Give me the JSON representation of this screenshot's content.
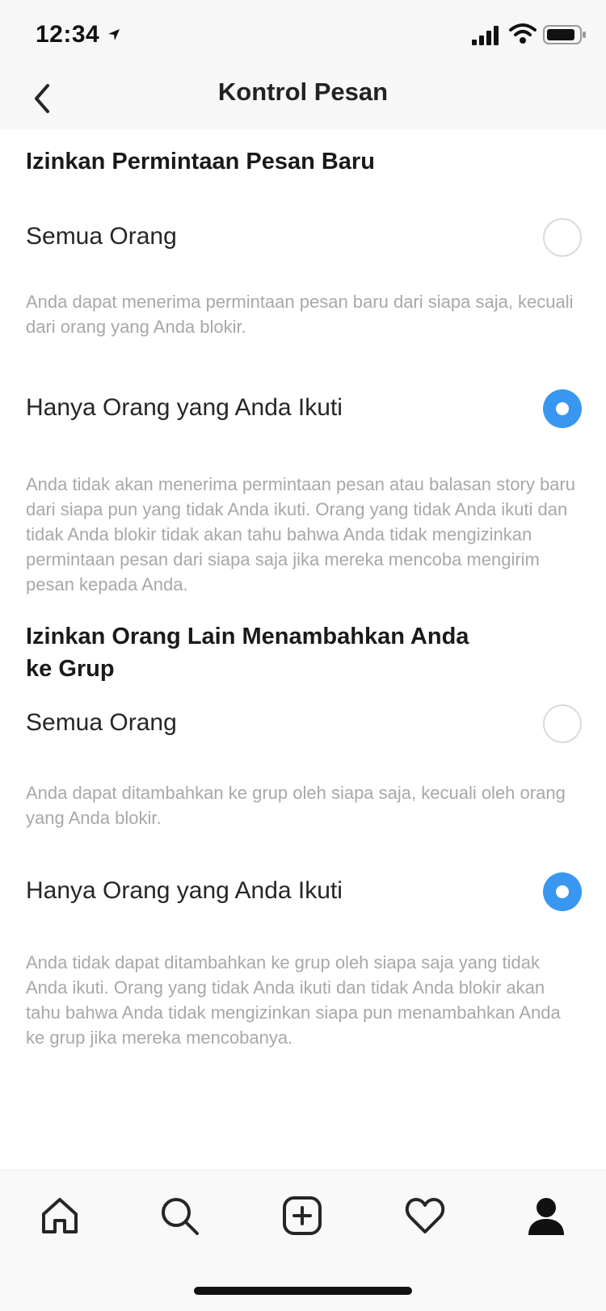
{
  "status_bar": {
    "time": "12:34"
  },
  "header": {
    "title": "Kontrol Pesan"
  },
  "sections": [
    {
      "title": "Izinkan Permintaan Pesan Baru",
      "options": [
        {
          "label": "Semua Orang",
          "selected": false,
          "description": "Anda dapat menerima permintaan pesan baru dari siapa saja, kecuali dari orang yang Anda blokir."
        },
        {
          "label": "Hanya Orang yang Anda Ikuti",
          "selected": true,
          "description": "Anda tidak akan menerima permintaan pesan atau balasan story baru dari siapa pun yang tidak Anda ikuti. Orang yang tidak Anda ikuti dan tidak Anda blokir tidak akan tahu bahwa Anda tidak mengizinkan permintaan pesan dari siapa saja jika mereka mencoba mengirim pesan kepada Anda."
        }
      ]
    },
    {
      "title": "Izinkan Orang Lain Menambahkan Anda ke Grup",
      "options": [
        {
          "label": "Semua Orang",
          "selected": false,
          "description": "Anda dapat ditambahkan ke grup oleh siapa saja, kecuali oleh orang yang Anda blokir."
        },
        {
          "label": "Hanya Orang yang Anda Ikuti",
          "selected": true,
          "description": "Anda tidak dapat ditambahkan ke grup oleh siapa saja yang tidak Anda ikuti. Orang yang tidak Anda ikuti dan tidak Anda blokir akan tahu bahwa Anda tidak mengizinkan siapa pun menambahkan Anda ke grup jika mereka mencobanya."
        }
      ]
    }
  ],
  "tab_bar": {
    "icons": [
      "home-icon",
      "search-icon",
      "new-post-icon",
      "activity-heart-icon",
      "profile-icon"
    ],
    "active": "profile-icon"
  },
  "colors": {
    "accent": "#3897f0",
    "header_bg": "#f7f7f7",
    "description_text": "#a8a8a8"
  }
}
